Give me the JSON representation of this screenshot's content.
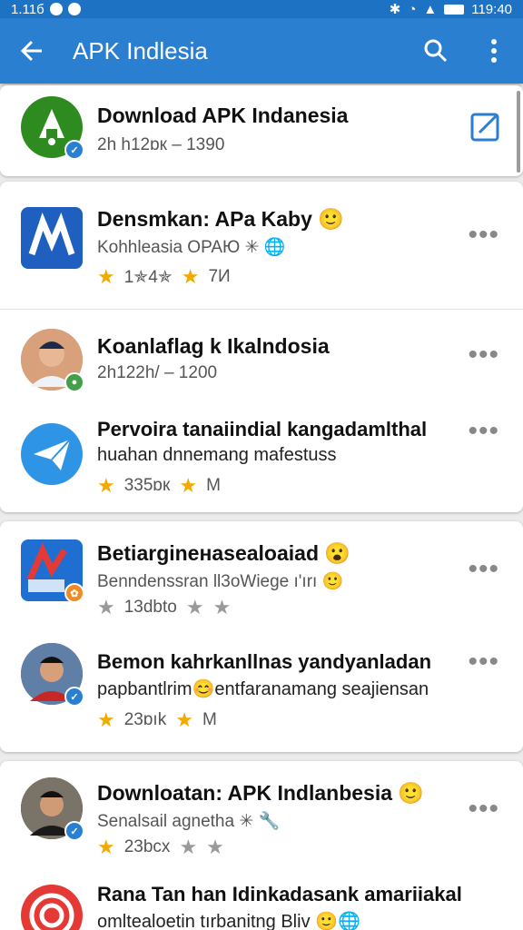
{
  "status_bar": {
    "time_left": "1.11б",
    "time_right": "119:40"
  },
  "app_bar": {
    "title": "APK Indlesia"
  },
  "items": [
    {
      "title": "Download APK Indanesia",
      "subtitle": "2h h12ɒк – 1390"
    },
    {
      "title": "Densmkan: APa Kaby 🙂",
      "subtitle": "Kohhleasia ОΡΑЮ ✳ 🌐",
      "rating": "1✯4✯",
      "extra": "7И"
    },
    {
      "title": "Koanlaflag k Ikalndosia",
      "subtitle": "2h122h/ – 1200"
    },
    {
      "title": "Pervoira tanaiindial kangadamlthal",
      "line2": "huahan dnnemang mafestuss",
      "rating": "335ɒк",
      "extra": "M"
    },
    {
      "title": "Betiargineнasealoaiad 😮",
      "subtitle": "Benndenssran ll3oWiege ı'ırı 🙂",
      "rating": "13dbto"
    },
    {
      "title": "Bemon kahrkanllnas yandyanladan",
      "line2": "papbantlrim😊entfaranamang seajiensan",
      "rating": "23ɒık",
      "extra": "M"
    },
    {
      "title": "Downloatan: APK Indlanbesia 🙂",
      "subtitle": "Senalsail agnetha ✳ 🔧",
      "rating": "23bcx"
    },
    {
      "title": "Rana Tan han Idinkadasank amariiakal",
      "line2": "omltealoetin tırbanitng Bliv 🙂🌐"
    }
  ]
}
